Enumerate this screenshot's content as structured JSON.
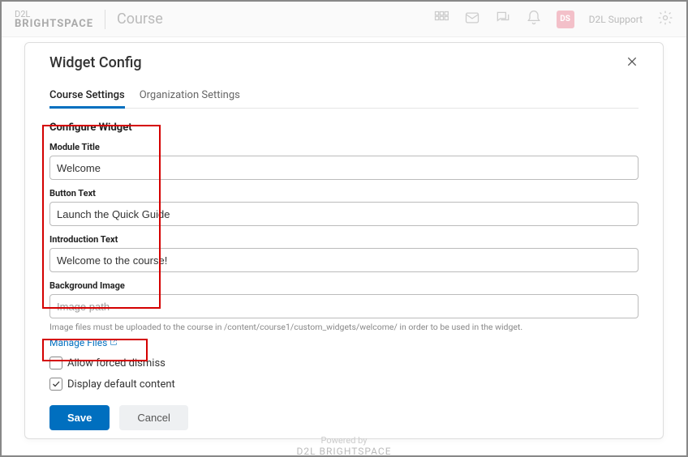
{
  "topbar": {
    "logo_small": "D2L",
    "logo_brand": "BRIGHTSPACE",
    "course_name": "Course",
    "user_initials": "DS",
    "user_name": "D2L Support"
  },
  "modal": {
    "title": "Widget Config",
    "tabs": {
      "course": "Course Settings",
      "org": "Organization Settings"
    },
    "section_title": "Configure Widget",
    "fields": {
      "module_title": {
        "label": "Module Title",
        "value": "Welcome"
      },
      "button_text": {
        "label": "Button Text",
        "value": "Launch the Quick Guide"
      },
      "intro_text": {
        "label": "Introduction Text",
        "value": "Welcome to the course!"
      },
      "bg_image": {
        "label": "Background Image",
        "placeholder": "Image path",
        "value": ""
      }
    },
    "helper_text": "Image files must be uploaded to the course in /content/course1/custom_widgets/welcome/ in order to be used in the widget.",
    "manage_files": "Manage Files",
    "checkboxes": {
      "allow_dismiss": {
        "label": "Allow forced dismiss",
        "checked": false
      },
      "display_default": {
        "label": "Display default content",
        "checked": true
      }
    },
    "buttons": {
      "save": "Save",
      "cancel": "Cancel"
    }
  },
  "footer": {
    "powered": "Powered by",
    "brand": "D2L  BRIGHTSPACE"
  }
}
